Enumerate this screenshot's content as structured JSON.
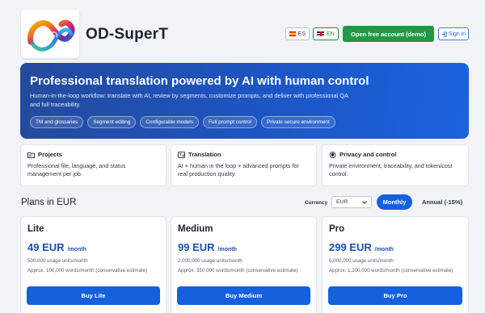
{
  "brand": {
    "name": "OD-SuperT"
  },
  "header": {
    "lang_es": "ES",
    "lang_en": "EN",
    "open_account": "Open free account (demo)",
    "sign_in": "Sign in"
  },
  "hero": {
    "title": "Professional translation powered by AI with human control",
    "description": "Human-in-the-loop workflow: translate with AI, review by segments, customize prompts, and deliver with professional QA and full traceability.",
    "chips": [
      "TM and glossaries",
      "Segment editing",
      "Configurable models",
      "Full prompt control",
      "Private secure environment"
    ]
  },
  "features": [
    {
      "title": "Projects",
      "text": "Professional file, language, and status management per job.",
      "icon": "folder-icon"
    },
    {
      "title": "Translation",
      "text": "AI + human in the loop + advanced prompts for real production quality.",
      "icon": "translate-icon"
    },
    {
      "title": "Privacy and control",
      "text": "Private environment, traceability, and token/cost control.",
      "icon": "shield-icon"
    }
  ],
  "plans_section": {
    "title": "Plans in EUR",
    "currency_label": "Currency",
    "currency_value": "EUR",
    "monthly_label": "Monthly",
    "annual_label": "Annual (-15%)"
  },
  "plans": [
    {
      "name": "Lite",
      "price": "49 EUR",
      "period": "/month",
      "units": "500,000 usage units/month",
      "words": "Approx. 100,000 words/month (conservative estimate)",
      "button": "Buy Lite"
    },
    {
      "name": "Medium",
      "price": "99 EUR",
      "period": "/month",
      "units": "2,000,000 usage units/month",
      "words": "Approx. 350,000 words/month (conservative estimate)",
      "button": "Buy Medium"
    },
    {
      "name": "Pro",
      "price": "299 EUR",
      "period": "/month",
      "units": "6,000,000 usage units/month",
      "words": "Approx. 1,200,000 words/month (conservative estimate)",
      "button": "Buy Pro"
    }
  ],
  "colors": {
    "primary": "#1560dc",
    "success": "#1f9a45",
    "hero_start": "#244a9c",
    "hero_end": "#1c62dd"
  }
}
